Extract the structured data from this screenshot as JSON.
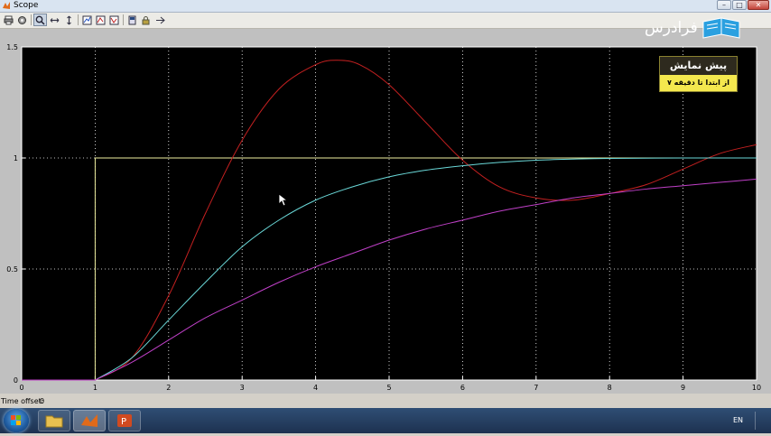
{
  "window": {
    "title": "Scope",
    "controls": {
      "minimize": "–",
      "maximize": "□",
      "close": "✕"
    }
  },
  "toolbar": {
    "buttons": [
      {
        "id": "print",
        "icon": "printer-icon"
      },
      {
        "id": "parameters",
        "icon": "gear-icon"
      },
      {
        "id": "zoom",
        "icon": "zoom-icon",
        "pressed": true
      },
      {
        "id": "zoom-x",
        "icon": "zoom-x-icon"
      },
      {
        "id": "zoom-y",
        "icon": "zoom-y-icon"
      },
      {
        "id": "autoscale",
        "icon": "autoscale-icon"
      },
      {
        "id": "save-axes",
        "icon": "save-axes-icon"
      },
      {
        "id": "restore-axes",
        "icon": "restore-axes-icon"
      },
      {
        "id": "floating-scope",
        "icon": "floating-scope-icon"
      },
      {
        "id": "lock-axes",
        "icon": "lock-icon"
      },
      {
        "id": "signal-selection",
        "icon": "signal-selection-icon"
      }
    ]
  },
  "status": {
    "time_offset_label": "Time offset:",
    "time_offset_value": "0"
  },
  "watermark": {
    "logo_text": "فرادرس"
  },
  "badge": {
    "title": "پیش نمایش",
    "subtitle": "از ابتدا تا دقیقه ۷"
  },
  "taskbar": {
    "lang": "EN"
  },
  "colors": {
    "plot_bg": "#000000",
    "axis": "#ffffff",
    "grid": "#ffffff",
    "step": "#f0f0a0",
    "red": "#c42020",
    "cyan": "#6ad8d8",
    "magenta": "#c040c8"
  },
  "chart_data": {
    "type": "line",
    "title": "",
    "xlabel": "",
    "ylabel": "",
    "xlim": [
      0,
      10
    ],
    "ylim": [
      0,
      1.5
    ],
    "xticks": [
      "0",
      "1",
      "2",
      "3",
      "4",
      "5",
      "6",
      "7",
      "8",
      "9",
      "10"
    ],
    "yticks": [
      "0",
      "0.5",
      "1",
      "1.5"
    ],
    "grid": true,
    "series": [
      {
        "color": "#f0f0a0",
        "x": [
          0,
          1,
          1,
          10
        ],
        "y": [
          0,
          0,
          1,
          1
        ]
      },
      {
        "color": "#c42020",
        "x": [
          0,
          1,
          1.5,
          2,
          2.5,
          3,
          3.5,
          4,
          4.3,
          4.6,
          5,
          5.5,
          6,
          6.5,
          7,
          7.5,
          8,
          8.5,
          9,
          9.5,
          10
        ],
        "y": [
          0,
          0,
          0.1,
          0.38,
          0.75,
          1.08,
          1.31,
          1.42,
          1.44,
          1.42,
          1.33,
          1.16,
          0.99,
          0.87,
          0.82,
          0.81,
          0.84,
          0.88,
          0.95,
          1.02,
          1.06
        ]
      },
      {
        "color": "#6ad8d8",
        "x": [
          0,
          1,
          1.5,
          2,
          2.5,
          3,
          3.5,
          4,
          4.5,
          5,
          5.5,
          6,
          6.5,
          7,
          7.5,
          8,
          9,
          10
        ],
        "y": [
          0,
          0,
          0.1,
          0.27,
          0.44,
          0.6,
          0.72,
          0.81,
          0.87,
          0.915,
          0.945,
          0.965,
          0.98,
          0.99,
          0.995,
          0.998,
          1.0,
          1.0
        ]
      },
      {
        "color": "#c040c8",
        "x": [
          0,
          1,
          1.5,
          2,
          2.5,
          3,
          3.5,
          4,
          4.5,
          5,
          5.5,
          6,
          6.5,
          7,
          7.5,
          8,
          8.5,
          9,
          9.5,
          10
        ],
        "y": [
          0,
          0,
          0.08,
          0.18,
          0.28,
          0.36,
          0.44,
          0.51,
          0.57,
          0.63,
          0.68,
          0.72,
          0.76,
          0.79,
          0.82,
          0.84,
          0.86,
          0.875,
          0.89,
          0.905
        ]
      }
    ]
  }
}
